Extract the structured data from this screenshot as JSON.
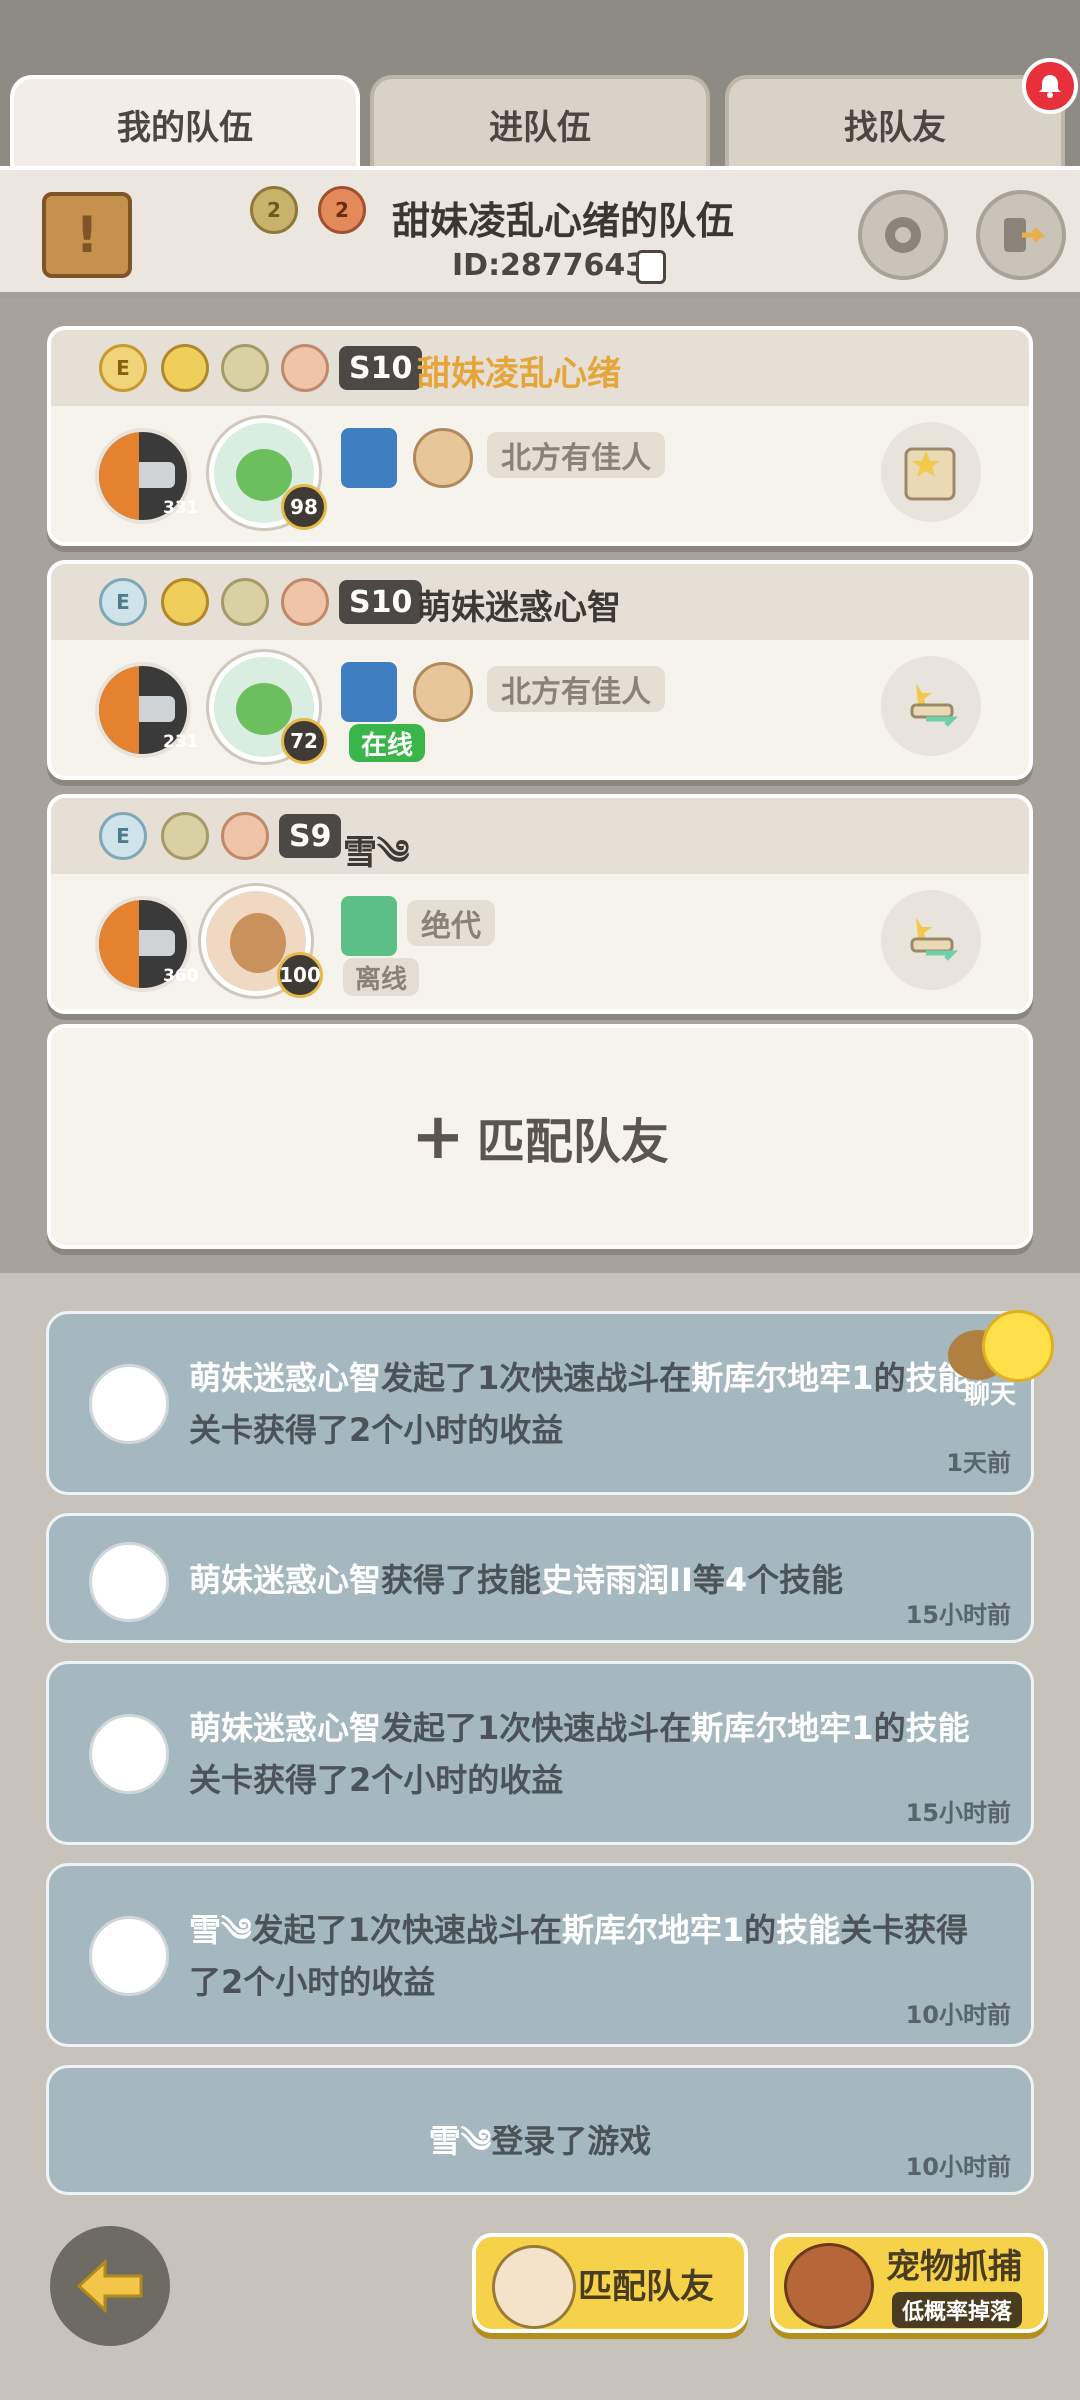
{
  "tabs": [
    {
      "label": "我的队伍"
    },
    {
      "label": "进队伍"
    },
    {
      "label": "找队友"
    }
  ],
  "team": {
    "badge1": "2",
    "badge2": "2",
    "name": "甜妹凌乱心绪的队伍",
    "id": "ID:2877643"
  },
  "members": [
    {
      "season": "S10",
      "name": "甜妹凌乱心绪",
      "name_color": "#e6a53b",
      "avatar_level": "331",
      "pet_level": "98",
      "guild": "北方有佳人",
      "status": ""
    },
    {
      "season": "S10",
      "name": "萌妹迷惑心智",
      "name_color": "#3f3935",
      "avatar_level": "231",
      "pet_level": "72",
      "guild": "北方有佳人",
      "status": "在线"
    },
    {
      "season": "S9",
      "name": "雪༄",
      "name_color": "#3f3935",
      "avatar_level": "360",
      "pet_level": "100",
      "guild": "绝代",
      "status": "离线"
    }
  ],
  "match_card": {
    "label": "匹配队友"
  },
  "chat": {
    "label": "聊天"
  },
  "feed": [
    {
      "name": "萌妹迷惑心智",
      "t1": "发起了1次快速战斗在",
      "place": "斯库尔地牢1",
      "t2": "的",
      "kind": "技能",
      "t3": "关卡获得了2个小时的收益",
      "time": "1天前"
    },
    {
      "name": "萌妹迷惑心智",
      "t1": "获得了技能",
      "place": "史诗雨润II",
      "t2": "等",
      "kind": "4",
      "t3": "个技能",
      "time": "15小时前"
    },
    {
      "name": "萌妹迷惑心智",
      "t1": "发起了1次快速战斗在",
      "place": "斯库尔地牢1",
      "t2": "的",
      "kind": "技能",
      "t3": "关卡获得了2个小时的收益",
      "time": "15小时前"
    },
    {
      "name": "雪༄",
      "t1": "发起了1次快速战斗在",
      "place": "斯库尔地牢1",
      "t2": "的",
      "kind": "技能",
      "t3": "关卡获得了2个小时的收益",
      "time": "10小时前"
    },
    {
      "name": "雪༄",
      "t1": "登录了游戏",
      "time": "10小时前"
    }
  ],
  "bottom": {
    "match_label": "匹配队友",
    "pet_label": "宠物抓捕",
    "pet_sub": "低概率掉落"
  }
}
